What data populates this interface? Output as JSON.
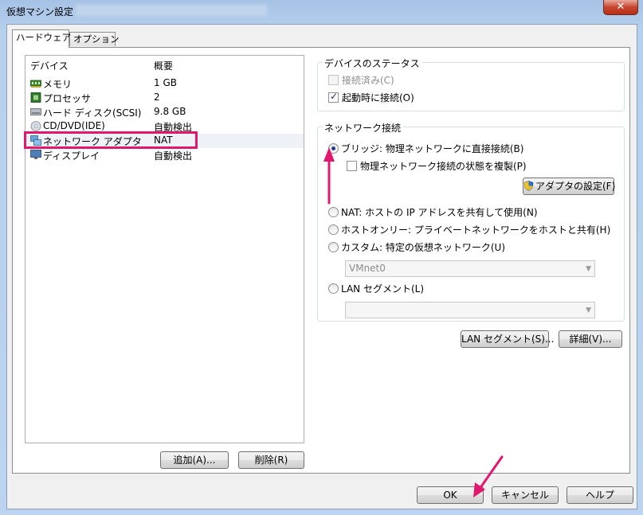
{
  "window": {
    "title": "仮想マシン設定",
    "close_symbol": "✕"
  },
  "tabs": [
    {
      "label": "ハードウェア",
      "active": true
    },
    {
      "label": "オプション",
      "active": false
    }
  ],
  "device_list": {
    "headers": {
      "device": "デバイス",
      "summary": "概要"
    },
    "items": [
      {
        "name": "メモリ",
        "summary": "1 GB",
        "icon": "memory-icon"
      },
      {
        "name": "プロセッサ",
        "summary": "2",
        "icon": "processor-icon"
      },
      {
        "name": "ハード ディスク(SCSI)",
        "summary": "9.8 GB",
        "icon": "hard-disk-icon"
      },
      {
        "name": "CD/DVD(IDE)",
        "summary": "自動検出",
        "icon": "cd-dvd-icon"
      },
      {
        "name": "ネットワーク アダプタ",
        "summary": "NAT",
        "icon": "network-adapter-icon",
        "selected": true
      },
      {
        "name": "ディスプレイ",
        "summary": "自動検出",
        "icon": "display-icon"
      }
    ]
  },
  "list_buttons": {
    "add": "追加(A)...",
    "remove": "削除(R)"
  },
  "device_status": {
    "group_label": "デバイスのステータス",
    "connected_label": "接続済み(C)",
    "connected_checked": false,
    "connect_at_power_on_label": "起動時に接続(O)",
    "connect_at_power_on_checked": true
  },
  "network_connection": {
    "group_label": "ネットワーク接続",
    "bridged_label": "ブリッジ: 物理ネットワークに直接接続(B)",
    "replicate_label": "物理ネットワーク接続の状態を複製(P)",
    "replicate_checked": false,
    "adapter_settings_label": "アダプタの設定(F)",
    "nat_label": "NAT: ホストの IP アドレスを共有して使用(N)",
    "host_only_label": "ホストオンリー: プライベートネットワークをホストと共有(H)",
    "custom_label": "カスタム: 特定の仮想ネットワーク(U)",
    "custom_network_value": "VMnet0",
    "lan_segment_label": "LAN セグメント(L)",
    "lan_segment_value": "",
    "selected": "bridged"
  },
  "network_buttons": {
    "lan_segments": "LAN セグメント(S)...",
    "advanced": "詳細(V)..."
  },
  "dialog_buttons": {
    "ok": "OK",
    "cancel": "キャンセル",
    "help": "ヘルプ"
  },
  "colors": {
    "annotation": "#e2186e",
    "title_gradient": "#a6c2e4",
    "close": "#c7452f"
  }
}
